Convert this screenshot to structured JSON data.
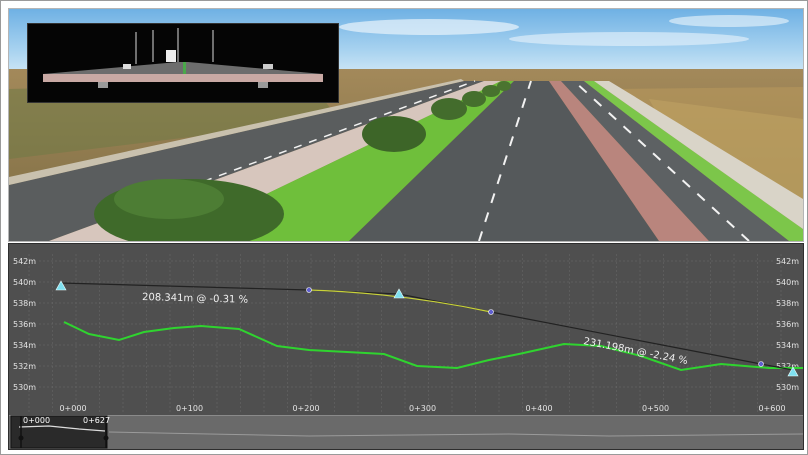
{
  "profile": {
    "elevation_labels": [
      "542m",
      "540m",
      "538m",
      "536m",
      "534m",
      "532m",
      "530m"
    ],
    "station_labels": [
      "0+000",
      "0+100",
      "0+200",
      "0+300",
      "0+400",
      "0+500",
      "0+600"
    ],
    "grade_annotations": [
      "208.341m @ -0.31 %",
      "231.198m @ -2.24 %"
    ]
  },
  "overview": {
    "start_station": "0+000",
    "window_station": "0+627"
  },
  "colors": {
    "ground_line": "#2fd42f",
    "design_line": "#222222",
    "vertical_curve": "#c9d23a",
    "pvi_marker": "#7fe0f0",
    "panel_bg": "#4f4f4f"
  }
}
